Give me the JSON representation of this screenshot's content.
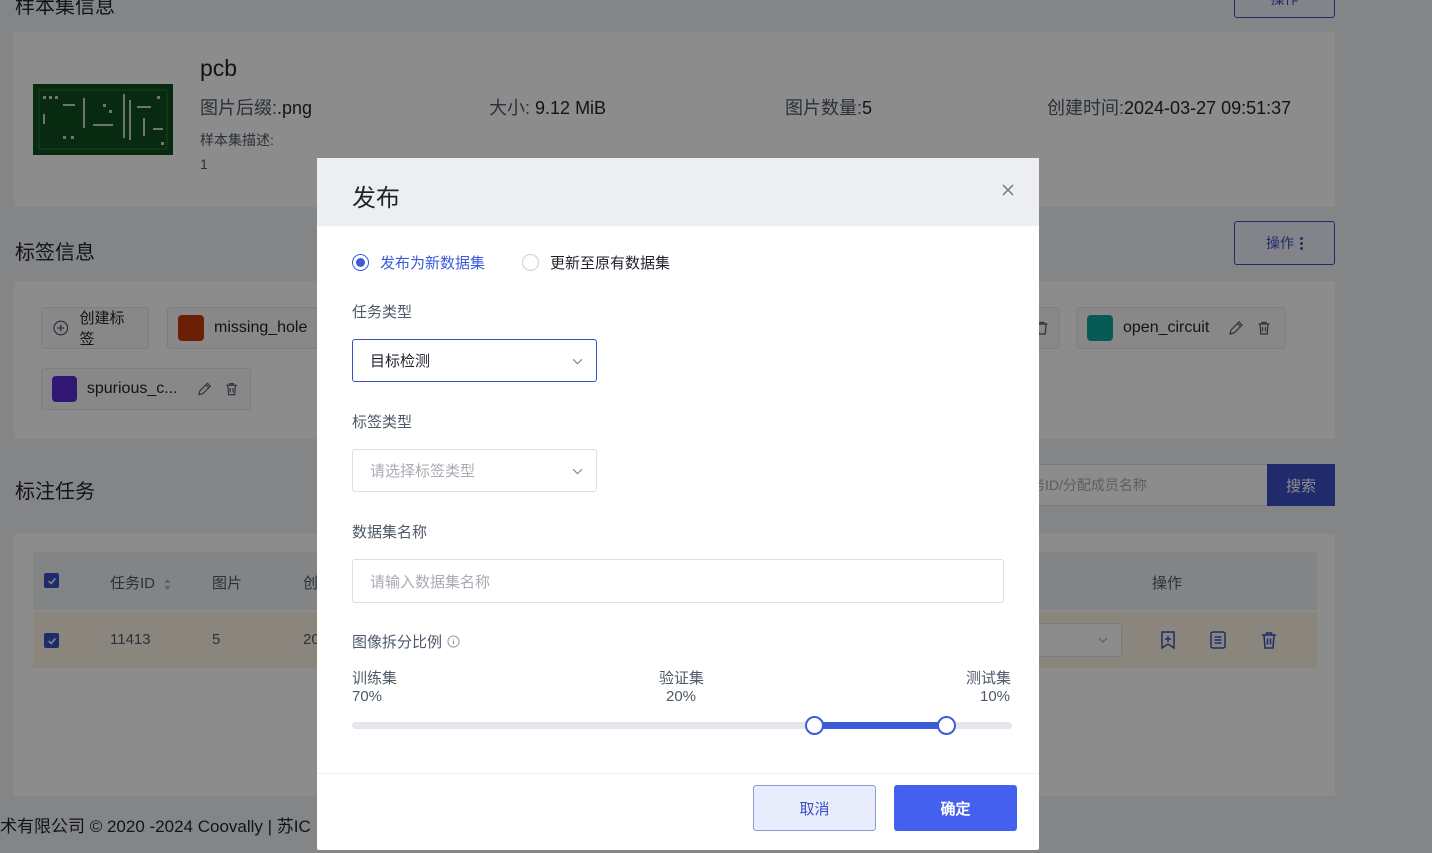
{
  "background": {
    "sample_section_title": "样本集信息",
    "sample_action_button": "操作",
    "sample": {
      "name": "pcb",
      "suffix_label": "图片后缀:",
      "suffix_value": ".png",
      "size_label": "大小:",
      "size_value": "9.12 MiB",
      "count_label": "图片数量:",
      "count_value": "5",
      "created_label": "创建时间:",
      "created_value": "2024-03-27 09:51:37",
      "desc_label": "样本集描述:",
      "desc_value": "1"
    },
    "label_section_title": "标签信息",
    "label_action_button": "操作",
    "create_label_button": "创建标签",
    "tags": [
      {
        "name": "missing_hole",
        "color": "#c73a0a"
      },
      {
        "name": "open_circuit",
        "color": "#0fa79a"
      },
      {
        "name": "spurious_c...",
        "color": "#5a2bd1"
      }
    ],
    "task_section_title": "标注任务",
    "search_placeholder": "务ID/分配成员名称",
    "search_button": "搜索",
    "table": {
      "headers": {
        "task_id": "任务ID",
        "images": "图片",
        "created": "创",
        "actions": "操作"
      },
      "row": {
        "task_id": "11413",
        "images": "5",
        "created": "20"
      }
    },
    "footer": "术有限公司 © 2020 -2024 Coovally | 苏IC"
  },
  "modal": {
    "title": "发布",
    "radio_new": "发布为新数据集",
    "radio_update": "更新至原有数据集",
    "task_type_label": "任务类型",
    "task_type_value": "目标检测",
    "label_type_label": "标签类型",
    "label_type_placeholder": "请选择标签类型",
    "dataset_name_label": "数据集名称",
    "dataset_name_placeholder": "请输入数据集名称",
    "split_label": "图像拆分比例",
    "split": {
      "train_label": "训练集",
      "train_pct": "70%",
      "train_value": 70,
      "val_label": "验证集",
      "val_pct": "20%",
      "val_value": 20,
      "test_label": "测试集",
      "test_pct": "10%",
      "test_value": 10
    },
    "cancel_button": "取消",
    "confirm_button": "确定"
  },
  "colors": {
    "primary": "#3b4fc4",
    "accent": "#4361ee"
  }
}
